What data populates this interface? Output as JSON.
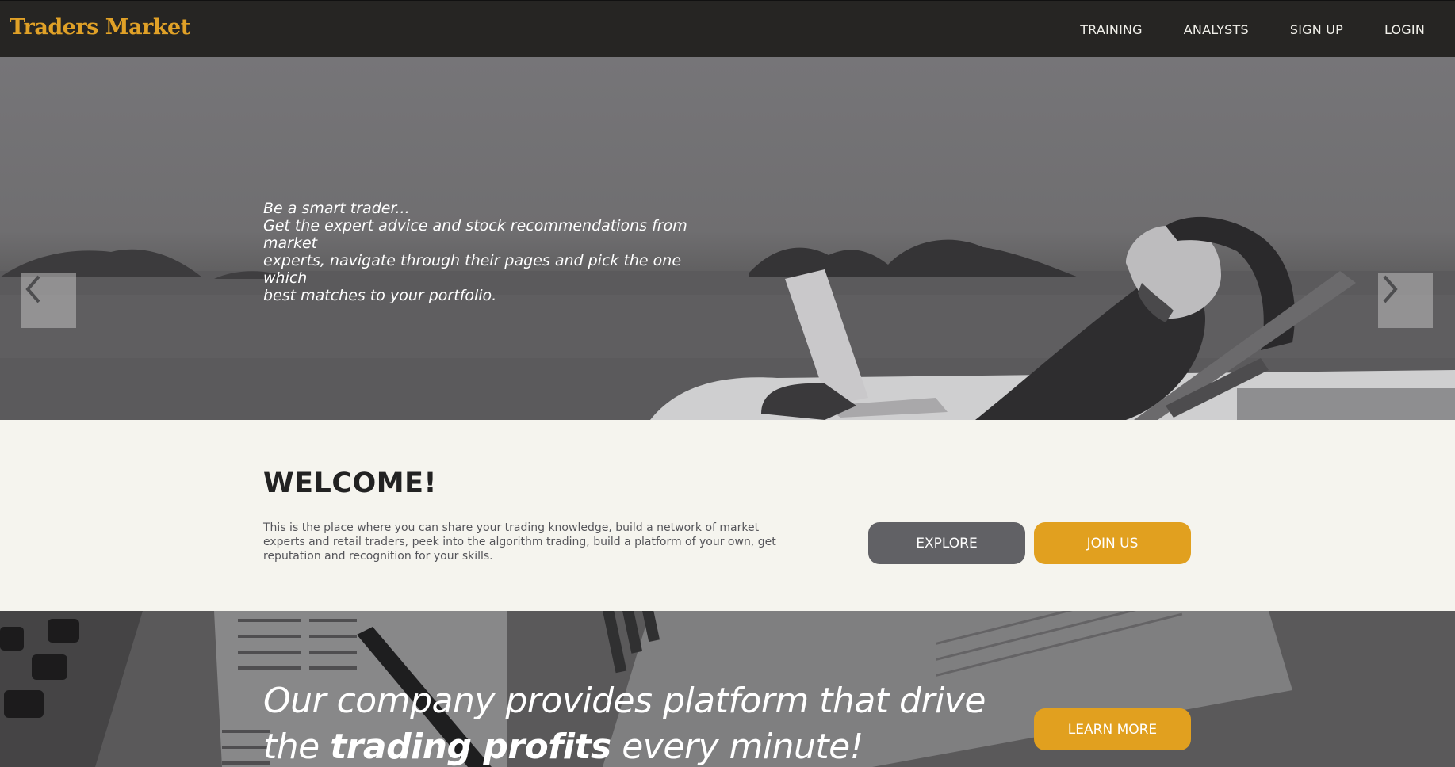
{
  "navbar": {
    "brand": "Traders Market",
    "links": [
      {
        "label": "TRAINING"
      },
      {
        "label": "ANALYSTS"
      },
      {
        "label": "SIGN UP"
      },
      {
        "label": "LOGIN"
      }
    ]
  },
  "hero": {
    "line1": "Be a smart trader...",
    "line2": "Get the expert advice and stock recommendations from market",
    "line3": "experts, navigate through their pages and pick the one which",
    "line4": "best matches to your portfolio.",
    "prev_icon": "chevron-left-icon",
    "next_icon": "chevron-right-icon"
  },
  "welcome": {
    "title": "WELCOME!",
    "body": "This is the place where you can share your trading knowledge, build a network of market experts and retail traders, peek into the algorithm trading, build a platform of your own, get reputation and recognition for your skills.",
    "explore_label": "EXPLORE",
    "join_label": "JOIN US"
  },
  "promo": {
    "text_start": "Our company provides platform that drive the ",
    "text_bold": "trading profits",
    "text_end": " every minute!",
    "learn_label": "LEARN MORE"
  },
  "colors": {
    "accent": "#e1a01f",
    "navbar_bg": "#262523",
    "page_bg": "#f5f4ee",
    "explore_bg": "#616165"
  }
}
